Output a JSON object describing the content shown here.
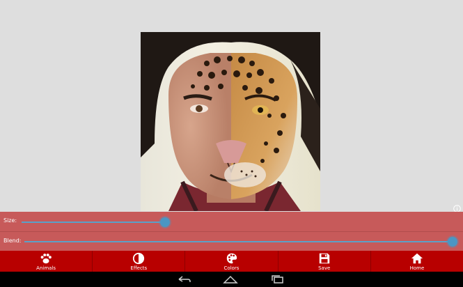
{
  "photo": {
    "description_icon": "face-morph-photo"
  },
  "info": {
    "icon": "info-icon"
  },
  "sliders": {
    "size": {
      "label": "Size:",
      "value": 0.33
    },
    "blend": {
      "label": "Blend:",
      "value": 0.98
    }
  },
  "toolbar": {
    "items": [
      {
        "label": "Animals",
        "icon": "paw-icon"
      },
      {
        "label": "Effects",
        "icon": "contrast-icon"
      },
      {
        "label": "Colors",
        "icon": "palette-icon"
      },
      {
        "label": "Save",
        "icon": "save-icon"
      },
      {
        "label": "Home",
        "icon": "home-icon"
      }
    ]
  },
  "navbar": {
    "buttons": [
      "back-icon",
      "home-icon",
      "recent-apps-icon"
    ]
  },
  "colors": {
    "slider_panel": "#c75a5a",
    "toolbar": "#b80000",
    "slider_accent": "#4b96c3"
  }
}
